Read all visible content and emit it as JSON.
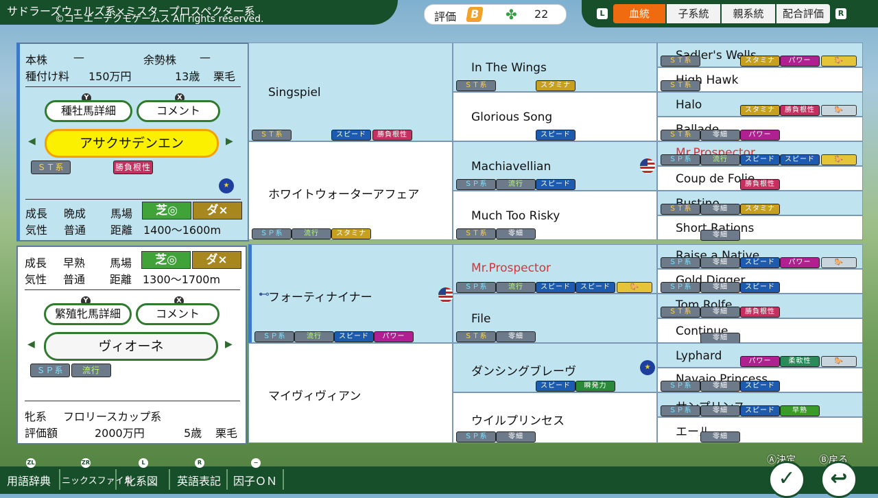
{
  "header": {
    "title_line1": "サドラーズウェルズ系×ミスタープロスペクター系",
    "title_line2": "©コーエーテクモゲームス All rights reserved.",
    "eval_label": "評価",
    "eval_grade": "B",
    "clover_count": "22",
    "tabs": [
      "血統",
      "子系統",
      "親系統",
      "配合評価"
    ],
    "tab_left_key": "L",
    "tab_right_key": "R"
  },
  "sire_panel": {
    "honkabu_label": "本株",
    "honkabu_value": "—",
    "yoseikabu_label": "余勢株",
    "yoseikabu_value": "—",
    "fee_label": "種付け料",
    "fee_value": "150万円",
    "age_value": "13歳",
    "coat_value": "栗毛",
    "detail_button": "種牡馬詳細",
    "comment_button": "コメント",
    "y_key": "Y",
    "x_key": "X",
    "name": "アサクサデンエン",
    "tag1": "ＳＴ系",
    "tag2": "勝負根性",
    "growth_label": "成長",
    "growth_value": "晩成",
    "track_label": "馬場",
    "turf": "芝◎",
    "dirt": "ダ×",
    "temper_label": "気性",
    "temper_value": "普通",
    "distance_label": "距離",
    "distance_value": "1400〜1600m"
  },
  "mare_panel": {
    "growth_label": "成長",
    "growth_value": "早熟",
    "track_label": "馬場",
    "turf": "芝◎",
    "dirt": "ダ×",
    "temper_label": "気性",
    "temper_value": "普通",
    "distance_label": "距離",
    "distance_value": "1300〜1700m",
    "detail_button": "繁殖牝馬詳細",
    "comment_button": "コメント",
    "y_key": "Y",
    "x_key": "X",
    "name": "ヴィオーネ",
    "tag1": "ＳＰ系",
    "tag2": "流行",
    "line_label": "牝系",
    "line_value": "フロリースカップ系",
    "value_label": "評価額",
    "value_value": "2000万円",
    "age_value": "5歳",
    "coat_value": "栗毛"
  },
  "pedigree": {
    "gen1": [
      "Singspiel",
      "ホワイトウォーターアフェア",
      "フォーティナイナー",
      "マイヴィヴィアン"
    ],
    "gen2": [
      "In The Wings",
      "Glorious Song",
      "Machiavellian",
      "Much Too Risky",
      "Mr.Prospector",
      "File",
      "ダンシングブレーヴ",
      "ウイルプリンセス"
    ],
    "gen3": [
      "Sadler's Wells",
      "High Hawk",
      "Halo",
      "Ballade",
      "Mr.Prospector",
      "Coup de Folie",
      "Bustino",
      "Short Rations",
      "Raise a Native",
      "Gold Digger",
      "Tom Rolfe",
      "Continue",
      "Lyphard",
      "Navajo Princess",
      "サンプリンス",
      "エール"
    ],
    "tags": {
      "st": "ＳＴ系",
      "sp": "ＳＰ系",
      "speed": "スピード",
      "guts": "勝負根性",
      "stamina": "スタミナ",
      "power": "パワー",
      "flex": "柔軟性",
      "burst": "瞬発力",
      "early": "早熟",
      "ryuko": "流行",
      "rare": "零細"
    },
    "horse_icon": "horse-icon"
  },
  "footer": {
    "items": [
      "用語辞典",
      "ニックスファイル",
      "牝系図",
      "英語表記",
      "因子ＯＮ"
    ],
    "keys": [
      "ZL",
      "ZR",
      "L",
      "R",
      "−"
    ],
    "decide_label": "Ⓐ決定",
    "back_label": "Ⓑ戻る",
    "decide_icon": "✓",
    "back_icon": "↩"
  }
}
